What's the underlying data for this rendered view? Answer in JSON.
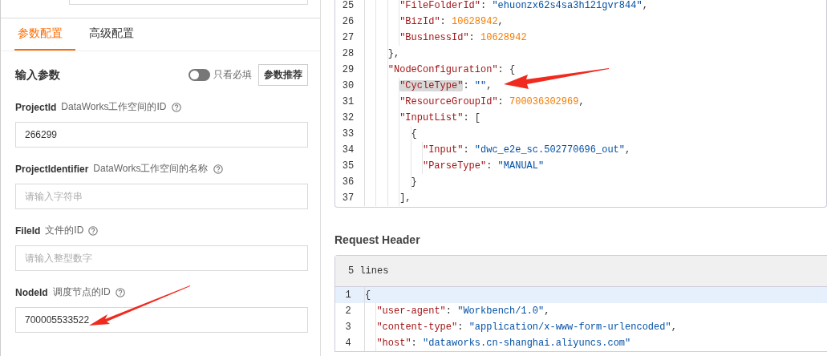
{
  "left_panel": {
    "tabs": [
      {
        "label": "参数配置",
        "selected": true
      },
      {
        "label": "高级配置",
        "selected": false
      }
    ],
    "section_title": "输入参数",
    "required_only_toggle": {
      "label": "只看必填",
      "on": false
    },
    "recommend_button": "参数推荐",
    "params": [
      {
        "name": "ProjectId",
        "description": "DataWorks工作空间的ID",
        "value": "266299"
      },
      {
        "name": "ProjectIdentifier",
        "description": "DataWorks工作空间的名称",
        "placeholder": "请输入字符串"
      },
      {
        "name": "FileId",
        "description": "文件的ID",
        "placeholder": "请输入整型数字"
      },
      {
        "name": "NodeId",
        "description": "调度节点的ID",
        "value": "700005533522"
      }
    ]
  },
  "body_code": {
    "lines": [
      {
        "children": [
          {
            "children": [
              {
                "children": [
                  {
                    "number": "25",
                    "tokens": [
                      {
                        "kind": "key",
                        "text": "\"FileFolderId\""
                      },
                      {
                        "kind": "punct",
                        "text": ": "
                      },
                      {
                        "kind": "str",
                        "text": "\"ehuonzx62s4sa3h121gvr844\""
                      },
                      {
                        "kind": "punct",
                        "text": ","
                      }
                    ]
                  },
                  {
                    "number": "26",
                    "tokens": [
                      {
                        "kind": "key",
                        "text": "\"BizId\""
                      },
                      {
                        "kind": "punct",
                        "text": ": "
                      },
                      {
                        "kind": "num",
                        "text": "10628942"
                      },
                      {
                        "kind": "punct",
                        "text": ","
                      }
                    ]
                  },
                  {
                    "number": "27",
                    "tokens": [
                      {
                        "kind": "key",
                        "text": "\"BusinessId\""
                      },
                      {
                        "kind": "punct",
                        "text": ": "
                      },
                      {
                        "kind": "num",
                        "text": "10628942"
                      }
                    ]
                  }
                ]
              },
              {
                "number": "28",
                "tokens": [
                  {
                    "kind": "punct",
                    "text": "},"
                  }
                ]
              },
              {
                "number": "29",
                "tokens": [
                  {
                    "kind": "key",
                    "text": "\"NodeConfiguration\""
                  },
                  {
                    "kind": "punct",
                    "text": ": {"
                  }
                ],
                "children": [
                  {
                    "number": "30",
                    "tokens": [
                      {
                        "kind": "hlkey",
                        "text": "\"CycleType\""
                      },
                      {
                        "kind": "punct",
                        "text": ": "
                      },
                      {
                        "kind": "str",
                        "text": "\"\""
                      },
                      {
                        "kind": "punct",
                        "text": ","
                      }
                    ]
                  },
                  {
                    "number": "31",
                    "tokens": [
                      {
                        "kind": "key",
                        "text": "\"ResourceGroupId\""
                      },
                      {
                        "kind": "punct",
                        "text": ": "
                      },
                      {
                        "kind": "num",
                        "text": "700036302969"
                      },
                      {
                        "kind": "punct",
                        "text": ","
                      }
                    ]
                  },
                  {
                    "number": "32",
                    "tokens": [
                      {
                        "kind": "key",
                        "text": "\"InputList\""
                      },
                      {
                        "kind": "punct",
                        "text": ": ["
                      }
                    ],
                    "children": [
                      {
                        "number": "33",
                        "tokens": [
                          {
                            "kind": "punct",
                            "text": "{"
                          }
                        ],
                        "children": [
                          {
                            "number": "34",
                            "tokens": [
                              {
                                "kind": "key",
                                "text": "\"Input\""
                              },
                              {
                                "kind": "punct",
                                "text": ": "
                              },
                              {
                                "kind": "str",
                                "text": "\"dwc_e2e_sc.502770696_out\""
                              },
                              {
                                "kind": "punct",
                                "text": ","
                              }
                            ]
                          },
                          {
                            "number": "35",
                            "tokens": [
                              {
                                "kind": "key",
                                "text": "\"ParseType\""
                              },
                              {
                                "kind": "punct",
                                "text": ": "
                              },
                              {
                                "kind": "str",
                                "text": "\"MANUAL\""
                              }
                            ]
                          }
                        ]
                      },
                      {
                        "number": "36",
                        "tokens": [
                          {
                            "kind": "punct",
                            "text": "}"
                          }
                        ]
                      }
                    ]
                  },
                  {
                    "number": "37",
                    "tokens": [
                      {
                        "kind": "punct",
                        "text": "],"
                      }
                    ]
                  }
                ]
              }
            ]
          }
        ]
      }
    ]
  },
  "request_header": {
    "title": "Request Header",
    "line_count": "5 lines",
    "lines": [
      {
        "number": "1",
        "current": true,
        "tokens": [
          {
            "kind": "punct",
            "text": "{"
          }
        ],
        "children": [
          {
            "number": "2",
            "current": false,
            "tokens": [
              {
                "kind": "key",
                "text": "\"user-agent\""
              },
              {
                "kind": "punct",
                "text": ": "
              },
              {
                "kind": "str",
                "text": "\"Workbench/1.0\""
              },
              {
                "kind": "punct",
                "text": ","
              }
            ]
          },
          {
            "number": "3",
            "current": false,
            "tokens": [
              {
                "kind": "key",
                "text": "\"content-type\""
              },
              {
                "kind": "punct",
                "text": ": "
              },
              {
                "kind": "str",
                "text": "\"application/x-www-form-urlencoded\""
              },
              {
                "kind": "punct",
                "text": ","
              }
            ]
          },
          {
            "number": "4",
            "current": false,
            "tokens": [
              {
                "kind": "key",
                "text": "\"host\""
              },
              {
                "kind": "punct",
                "text": ": "
              },
              {
                "kind": "str",
                "text": "\"dataworks.cn-shanghai.aliyuncs.com\""
              }
            ]
          }
        ]
      }
    ]
  }
}
